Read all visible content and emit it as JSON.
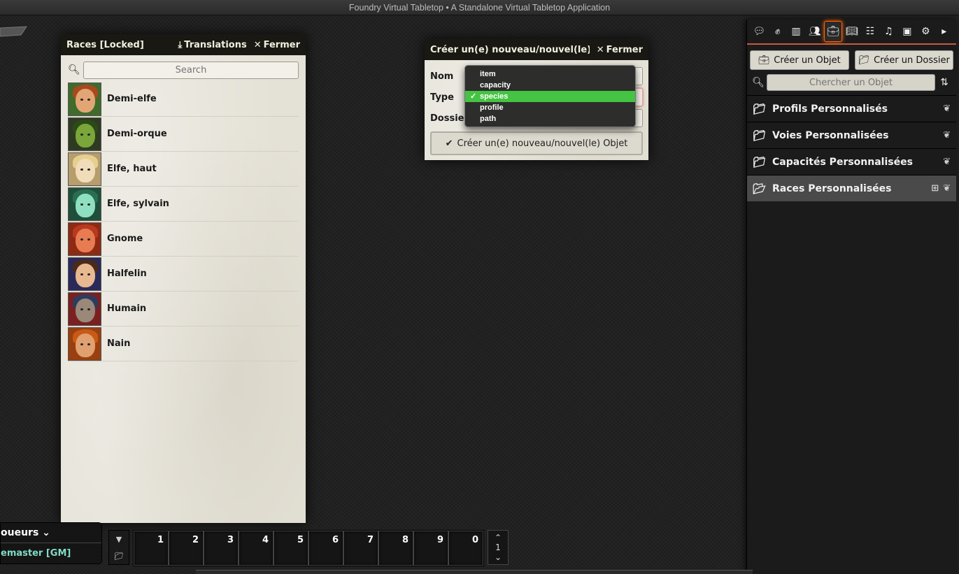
{
  "window_title": "Foundry Virtual Tabletop • A Standalone Virtual Tabletop Application",
  "compendium": {
    "title": "Races [Locked]",
    "translations_label": "Translations",
    "close_label": "Fermer",
    "search_placeholder": "Search",
    "entries": [
      {
        "name": "Demi-elfe",
        "skin": "#e2a574",
        "hair": "#a8481d",
        "bg": "#3f6b2c"
      },
      {
        "name": "Demi-orque",
        "skin": "#7aa63a",
        "hair": "#2c4a18",
        "bg": "#2e3a22"
      },
      {
        "name": "Elfe, haut",
        "skin": "#f0dcb8",
        "hair": "#e6cf8e",
        "bg": "#b59d6c"
      },
      {
        "name": "Elfe, sylvain",
        "skin": "#8fe0c0",
        "hair": "#2a6e52",
        "bg": "#1f4f3a"
      },
      {
        "name": "Gnome",
        "skin": "#e77b52",
        "hair": "#b83a1e",
        "bg": "#8e2a14"
      },
      {
        "name": "Halfelin",
        "skin": "#e8b890",
        "hair": "#4a2a18",
        "bg": "#2a2a5a"
      },
      {
        "name": "Humain",
        "skin": "#9a8878",
        "hair": "#2e3b5e",
        "bg": "#7a2020"
      },
      {
        "name": "Nain",
        "skin": "#e0a070",
        "hair": "#c85a16",
        "bg": "#9a4010"
      }
    ]
  },
  "create_dialog": {
    "title": "Créer un(e) nouveau/nouvel(le) Objet",
    "close_label": "Fermer",
    "name_label": "Nom",
    "type_label": "Type",
    "folder_label": "Dossier",
    "submit_label": "Créer un(e) nouveau/nouvel(le) Objet",
    "type_options": [
      "item",
      "capacity",
      "species",
      "profile",
      "path"
    ],
    "selected_type": "species"
  },
  "sidebar": {
    "tabs": [
      "chat-icon",
      "combat-icon",
      "scenes-icon",
      "actors-icon",
      "items-icon",
      "journal-icon",
      "tables-icon",
      "playlists-icon",
      "compendium-icon",
      "settings-icon",
      "collapse-icon"
    ],
    "active_tab": "items-icon",
    "create_item_label": "Créer un Objet",
    "create_folder_label": "Créer un Dossier",
    "search_placeholder": "Chercher un Objet",
    "folders": [
      {
        "name": "Profils Personnalisés",
        "open": false
      },
      {
        "name": "Voies Personnalisées",
        "open": false
      },
      {
        "name": "Capacités Personnalisées",
        "open": false
      },
      {
        "name": "Races Personnalisées",
        "open": true
      }
    ]
  },
  "players": {
    "header": "oueurs",
    "user": "emaster [GM]"
  },
  "hotbar": {
    "slots": [
      "1",
      "2",
      "3",
      "4",
      "5",
      "6",
      "7",
      "8",
      "9",
      "0"
    ],
    "page": "1"
  },
  "colors": {
    "accent": "#ff6400",
    "selected_option": "#45c443",
    "player_name": "#82dcc3"
  }
}
